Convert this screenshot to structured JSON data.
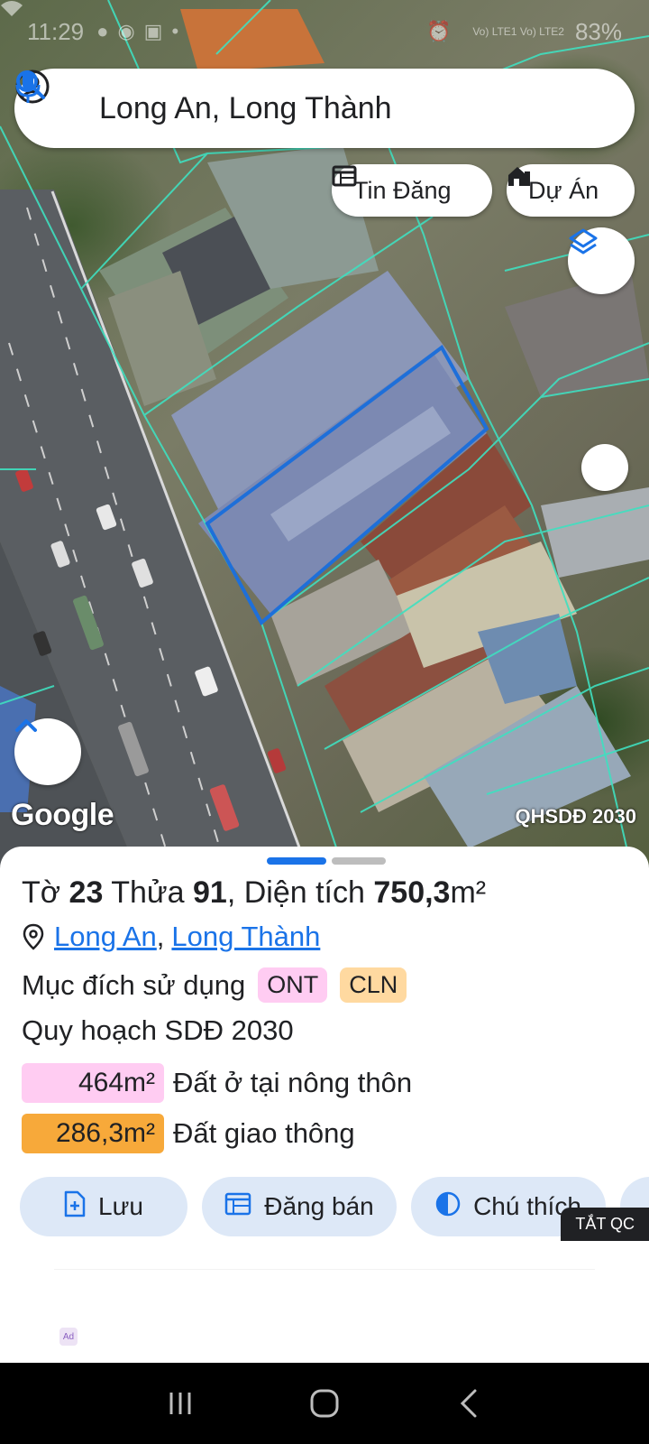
{
  "status_bar": {
    "time": "11:29",
    "network": "Vo) LTE1 Vo) LTE2",
    "battery": "83%"
  },
  "search": {
    "query": "Long An, Long Thành"
  },
  "map_chips": {
    "tin_dang": "Tin Đăng",
    "du_an": "Dự Án"
  },
  "map": {
    "google_label": "Google",
    "layer_label": "QHSDĐ 2030"
  },
  "sheet": {
    "title": {
      "to_label": "Tờ",
      "to_value": "23",
      "thua_label": "Thửa",
      "thua_value": "91",
      "dientich_label": ", Diện tích",
      "dientich_value": "750,3",
      "unit": "m²"
    },
    "location": {
      "province": "Long An",
      "separator": ",",
      "district": "Long Thành"
    },
    "purpose_label": "Mục đích sử dụng",
    "badges": [
      "ONT",
      "CLN"
    ],
    "plan_label": "Quy hoạch SDĐ 2030",
    "areas": [
      {
        "value": "464m²",
        "label": "Đất ở tại nông thôn",
        "color": "#ffccf2"
      },
      {
        "value": "286,3m²",
        "label": "Đất giao thông",
        "color": "#f7a93a"
      }
    ],
    "actions": {
      "save": "Lưu",
      "post": "Đăng bán",
      "legend": "Chú thích"
    },
    "ad_toggle": "TẮT QC",
    "ad_badge": "Ad"
  },
  "colors": {
    "accent": "#1a73e8",
    "parcel_outline": "#1e6fd9",
    "boundary": "#3fe0c0"
  }
}
